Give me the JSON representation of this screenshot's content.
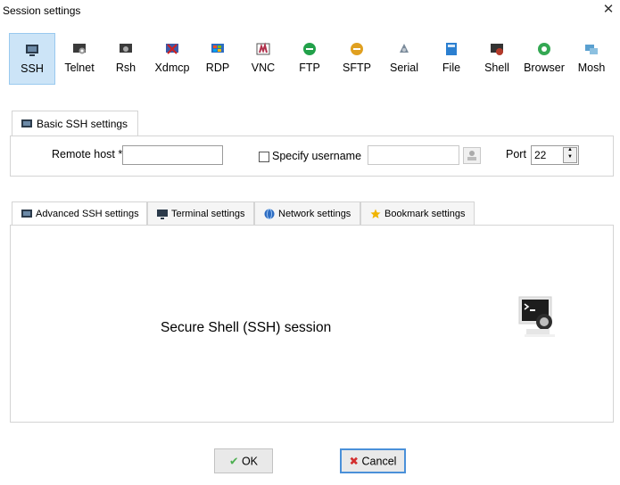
{
  "window": {
    "title": "Session settings",
    "close_glyph": "✕"
  },
  "protocols": [
    {
      "label": "SSH",
      "icon": "ssh-icon",
      "color": "#2b3a4a",
      "active": true
    },
    {
      "label": "Telnet",
      "icon": "telnet-icon",
      "color": "#3a3a3a"
    },
    {
      "label": "Rsh",
      "icon": "rsh-icon",
      "color": "#3a3a3a"
    },
    {
      "label": "Xdmcp",
      "icon": "xdmcp-icon",
      "color": "#3d5aa8"
    },
    {
      "label": "RDP",
      "icon": "rdp-icon",
      "color": "#2d6cc2"
    },
    {
      "label": "VNC",
      "icon": "vnc-icon",
      "color": "#b0304b"
    },
    {
      "label": "FTP",
      "icon": "ftp-icon",
      "color": "#22a14a"
    },
    {
      "label": "SFTP",
      "icon": "sftp-icon",
      "color": "#e0a020"
    },
    {
      "label": "Serial",
      "icon": "serial-icon",
      "color": "#7a8a9a"
    },
    {
      "label": "File",
      "icon": "file-icon",
      "color": "#2b7fd0"
    },
    {
      "label": "Shell",
      "icon": "shell-icon",
      "color": "#b33a2a"
    },
    {
      "label": "Browser",
      "icon": "browser-icon",
      "color": "#34a853"
    },
    {
      "label": "Mosh",
      "icon": "mosh-icon",
      "color": "#5aa0d0"
    }
  ],
  "basic": {
    "tab_label": "Basic SSH settings",
    "remote_host_label": "Remote host *",
    "remote_host_value": "",
    "specify_username_label": "Specify username",
    "username_value": "",
    "port_label": "Port",
    "port_value": "22",
    "spin_up": "▲",
    "spin_down": "▼"
  },
  "tabs": [
    {
      "label": "Advanced SSH settings",
      "icon": "terminal-icon",
      "color": "#2b3a4a"
    },
    {
      "label": "Terminal settings",
      "icon": "monitor-icon",
      "color": "#2b3a4a"
    },
    {
      "label": "Network settings",
      "icon": "globe-icon",
      "color": "#2d6cc2"
    },
    {
      "label": "Bookmark settings",
      "icon": "star-icon",
      "color": "#f0b400"
    }
  ],
  "panel": {
    "description": "Secure Shell (SSH) session"
  },
  "buttons": {
    "ok": "OK",
    "cancel": "Cancel",
    "ok_glyph": "✔",
    "cancel_glyph": "✖"
  }
}
